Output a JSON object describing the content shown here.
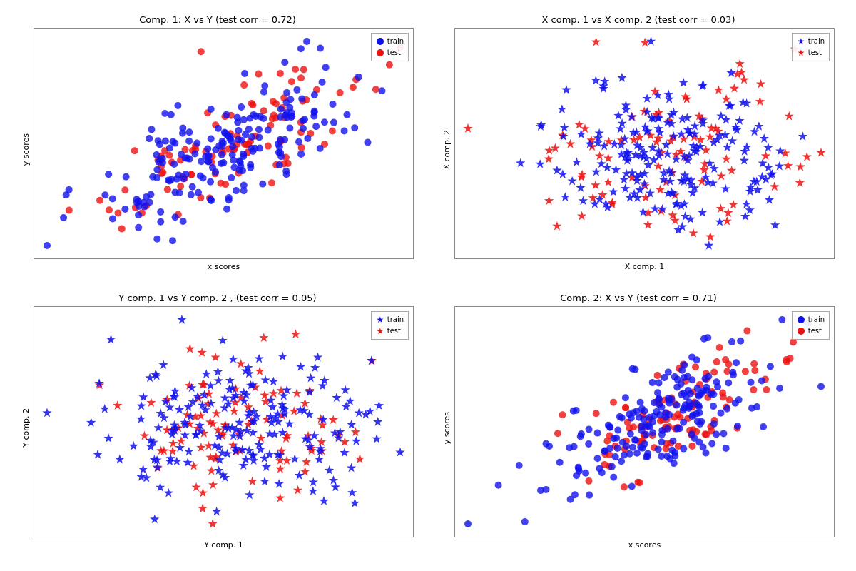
{
  "charts": [
    {
      "id": "chart-tl",
      "title": "Comp. 1: X vs Y (test corr = 0.72)",
      "x_label": "x scores",
      "y_label": "y scores",
      "legend_type": "circle",
      "position": "top-left"
    },
    {
      "id": "chart-tr",
      "title": "X comp. 1 vs X comp. 2 (test corr = 0.03)",
      "x_label": "X comp. 1",
      "y_label": "X comp. 2",
      "legend_type": "star",
      "position": "top-right"
    },
    {
      "id": "chart-bl",
      "title": "Y comp. 1 vs Y comp. 2 , (test corr = 0.05)",
      "x_label": "Y comp. 1",
      "y_label": "Y comp. 2",
      "legend_type": "star",
      "position": "bottom-left"
    },
    {
      "id": "chart-br",
      "title": "Comp. 2: X vs Y (test corr = 0.71)",
      "x_label": "x scores",
      "y_label": "y scores",
      "legend_type": "circle",
      "position": "bottom-right"
    }
  ],
  "legend": {
    "train_label": "train",
    "test_label": "test",
    "train_color": "#1111ee",
    "test_color": "#ee1111"
  }
}
